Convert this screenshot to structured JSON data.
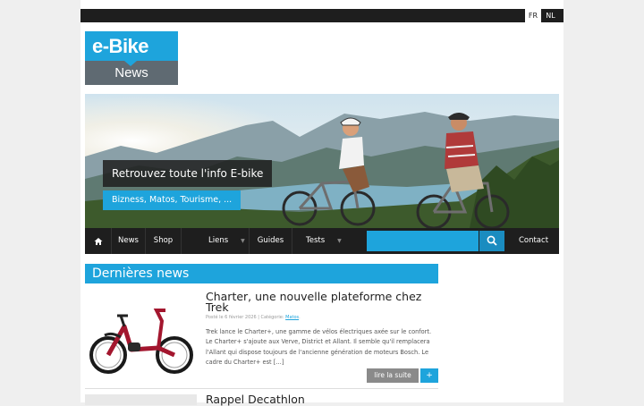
{
  "languages": [
    {
      "code": "FR"
    },
    {
      "code": "NL"
    }
  ],
  "logo": {
    "top_text": "e-Bike",
    "bottom_text": "News"
  },
  "hero": {
    "title": "Retrouvez toute l'info E-bike",
    "subtitle": "Bizness, Matos, Tourisme, ..."
  },
  "nav": {
    "home_icon": "home-icon",
    "items": [
      {
        "label": "News"
      },
      {
        "label": "Shop"
      },
      {
        "label": "Liens",
        "dropdown": true
      },
      {
        "label": "Guides"
      },
      {
        "label": "Tests",
        "dropdown": true
      }
    ],
    "search_placeholder": "",
    "search_icon": "search-icon",
    "contact_label": "Contact"
  },
  "section": {
    "title": "Dernières news"
  },
  "articles": [
    {
      "title": "Charter, une nouvelle plateforme chez Trek",
      "meta_prefix": "Posté le 6 février 2026 | Catégorie: ",
      "category": "Matos",
      "meta_suffix": ".",
      "excerpt": "Trek lance le Charter+, une gamme de vélos électriques axée sur le confort. Le Charter+ s'ajoute aux Verve, District et Allant. Il semble qu'il remplacera l'Allant qui dispose toujours de l'ancienne génération de moteurs Bosch. Le cadre du Charter+ est […]",
      "read_more": "lire la suite",
      "plus": "+"
    },
    {
      "title": "Rappel Decathlon"
    }
  ],
  "colors": {
    "accent": "#1ea4dc",
    "dark": "#1e1e1e",
    "logo_gray": "#5f6a72"
  }
}
